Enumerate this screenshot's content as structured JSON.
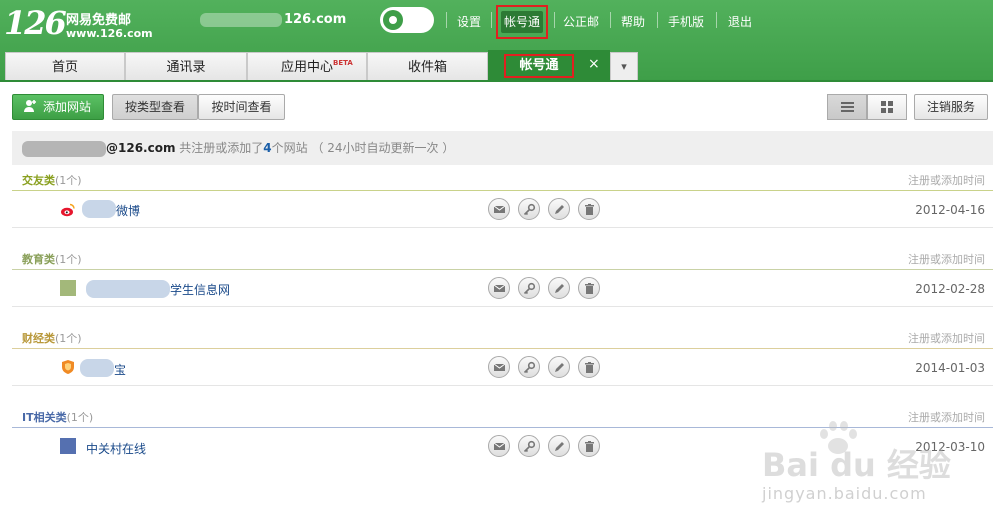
{
  "header": {
    "logo_number": "126",
    "logo_name": "网易免费邮",
    "logo_url": "www.126.com",
    "account_suffix": "126.com",
    "links": [
      "设置",
      "帐号通",
      "公正邮",
      "帮助",
      "手机版",
      "退出"
    ],
    "active_link": "帐号通"
  },
  "tabs": [
    {
      "label": "首页"
    },
    {
      "label": "通讯录"
    },
    {
      "label": "应用中心",
      "badge": "BETA"
    },
    {
      "label": "收件箱"
    }
  ],
  "active_tab": {
    "label": "帐号通",
    "close": "×"
  },
  "tab_more": "▾",
  "toolbar": {
    "add_site": "添加网站",
    "by_type": "按类型查看",
    "by_time": "按时间查看",
    "cancel_service": "注销服务"
  },
  "summary": {
    "account": "@126.com",
    "text_before": " 共注册或添加了",
    "count": "4",
    "text_after": "个网站 （ 24小时自动更新一次 ）"
  },
  "column_label": "注册或添加时间",
  "categories": [
    {
      "name": "交友类",
      "count": "(1个)",
      "color": "#8aa020",
      "line": "#c9d28a",
      "site": {
        "name": "微博",
        "date": "2012-04-16",
        "icon": "weibo-icon"
      }
    },
    {
      "name": "教育类",
      "count": "(1个)",
      "color": "#8aa05a",
      "line": "#c9d2a6",
      "site": {
        "name": "学生信息网",
        "date": "2012-02-28",
        "icon": "education-square-icon"
      }
    },
    {
      "name": "财经类",
      "count": "(1个)",
      "color": "#b8983a",
      "line": "#dccf9c",
      "site": {
        "name": "宝",
        "date": "2014-01-03",
        "icon": "shield-icon"
      }
    },
    {
      "name": "IT相关类",
      "count": "(1个)",
      "color": "#4a6aa8",
      "line": "#a8b8d8",
      "site": {
        "name": "中关村在线",
        "date": "2012-03-10",
        "icon": "it-square-icon"
      }
    }
  ],
  "watermark": {
    "brand": "Bai du 经验",
    "url": "jingyan.baidu.com"
  }
}
